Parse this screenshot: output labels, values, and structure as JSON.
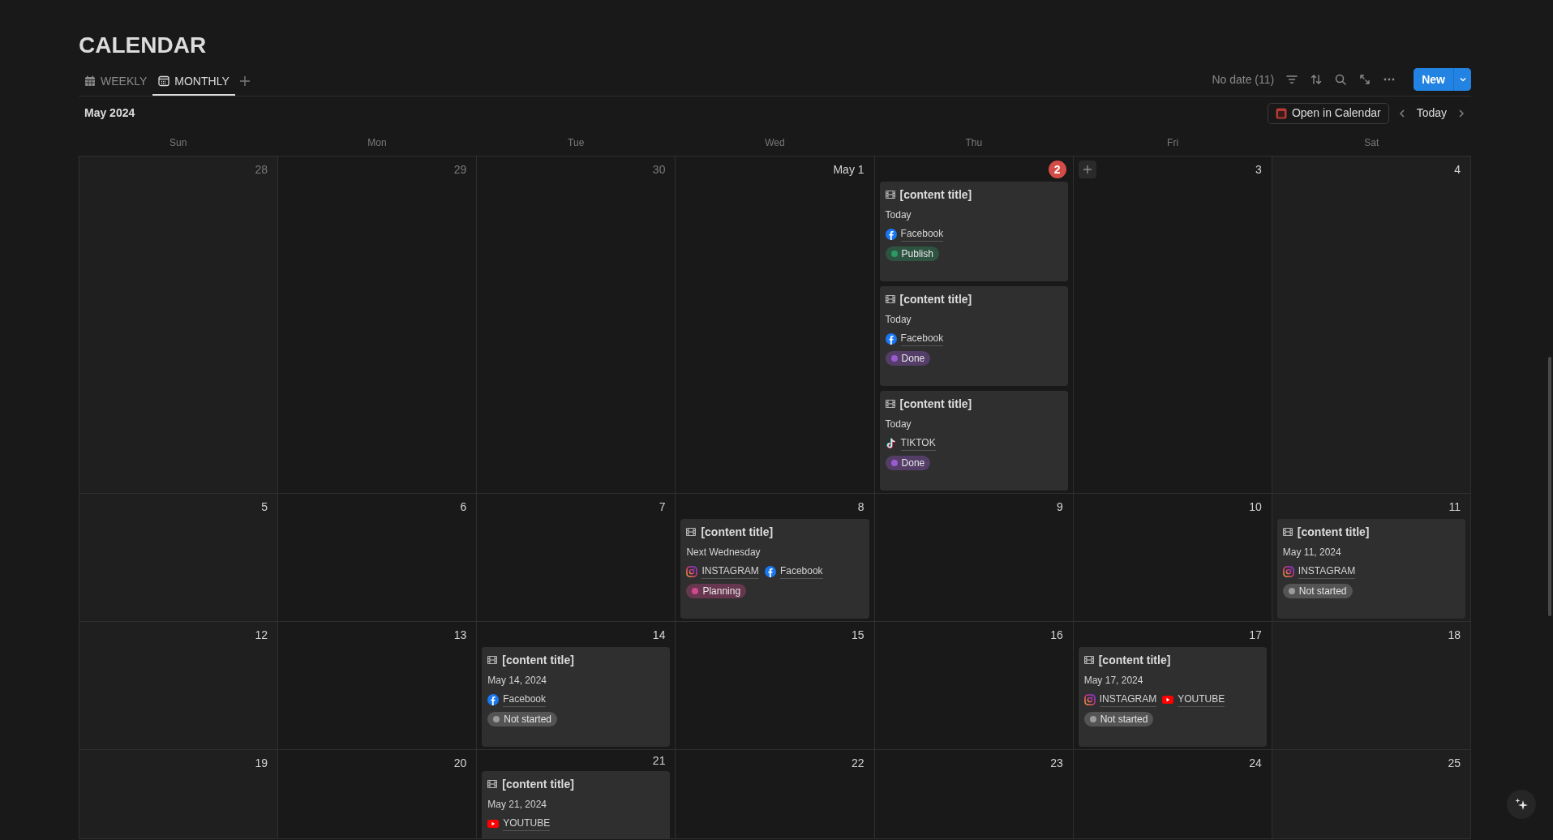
{
  "page_title": "CALENDAR",
  "tabs": [
    {
      "label": "WEEKLY",
      "kind": "week",
      "selected": false
    },
    {
      "label": "MONTHLY",
      "kind": "month",
      "selected": true
    }
  ],
  "toolbar": {
    "no_date": "No date (11)",
    "new_button": "New"
  },
  "month_label": "May 2024",
  "open_in_calendar": "Open in Calendar",
  "today_button": "Today",
  "weekdays": [
    "Sun",
    "Mon",
    "Tue",
    "Wed",
    "Thu",
    "Fri",
    "Sat"
  ],
  "weeks": [
    [
      {
        "day": "28",
        "in_month": false,
        "today": false,
        "hovered": false
      },
      {
        "day": "29",
        "in_month": false,
        "today": false,
        "hovered": false
      },
      {
        "day": "30",
        "in_month": false,
        "today": false,
        "hovered": false
      },
      {
        "day": "May 1",
        "in_month": true,
        "today": false,
        "hovered": false
      },
      {
        "day": "2",
        "in_month": true,
        "today": true,
        "hovered": false,
        "events": [
          {
            "title": "[content title]",
            "date": "Today",
            "platforms": [
              {
                "name": "Facebook",
                "kind": "facebook"
              }
            ],
            "status": {
              "label": "Publish",
              "color": "#2d9964"
            }
          },
          {
            "title": "[content title]",
            "date": "Today",
            "platforms": [
              {
                "name": "Facebook",
                "kind": "facebook"
              }
            ],
            "status": {
              "label": "Done",
              "color": "#9a5bd0"
            }
          },
          {
            "title": "[content title]",
            "date": "Today",
            "platforms": [
              {
                "name": "TIKTOK",
                "kind": "tiktok"
              }
            ],
            "status": {
              "label": "Done",
              "color": "#9a5bd0"
            }
          }
        ]
      },
      {
        "day": "3",
        "in_month": true,
        "today": false,
        "hovered": true
      },
      {
        "day": "4",
        "in_month": true,
        "today": false,
        "hovered": false
      }
    ],
    [
      {
        "day": "5",
        "in_month": true,
        "today": false,
        "hovered": false
      },
      {
        "day": "6",
        "in_month": true,
        "today": false,
        "hovered": false
      },
      {
        "day": "7",
        "in_month": true,
        "today": false,
        "hovered": false
      },
      {
        "day": "8",
        "in_month": true,
        "today": false,
        "hovered": false,
        "events": [
          {
            "title": "[content title]",
            "date": "Next Wednesday",
            "platforms": [
              {
                "name": "INSTAGRAM",
                "kind": "instagram"
              },
              {
                "name": "Facebook",
                "kind": "facebook"
              }
            ],
            "status": {
              "label": "Planning",
              "color": "#d2478e"
            }
          }
        ]
      },
      {
        "day": "9",
        "in_month": true,
        "today": false,
        "hovered": false
      },
      {
        "day": "10",
        "in_month": true,
        "today": false,
        "hovered": false
      },
      {
        "day": "11",
        "in_month": true,
        "today": false,
        "hovered": false,
        "events": [
          {
            "title": "[content title]",
            "date": "May 11, 2024",
            "platforms": [
              {
                "name": "INSTAGRAM",
                "kind": "instagram"
              }
            ],
            "status": {
              "label": "Not started",
              "color": "#9b9b9b"
            }
          }
        ]
      }
    ],
    [
      {
        "day": "12",
        "in_month": true,
        "today": false,
        "hovered": false
      },
      {
        "day": "13",
        "in_month": true,
        "today": false,
        "hovered": false
      },
      {
        "day": "14",
        "in_month": true,
        "today": false,
        "hovered": false,
        "events": [
          {
            "title": "[content title]",
            "date": "May 14, 2024",
            "platforms": [
              {
                "name": "Facebook",
                "kind": "facebook"
              }
            ],
            "status": {
              "label": "Not started",
              "color": "#9b9b9b"
            }
          }
        ]
      },
      {
        "day": "15",
        "in_month": true,
        "today": false,
        "hovered": false
      },
      {
        "day": "16",
        "in_month": true,
        "today": false,
        "hovered": false
      },
      {
        "day": "17",
        "in_month": true,
        "today": false,
        "hovered": false,
        "events": [
          {
            "title": "[content title]",
            "date": "May 17, 2024",
            "platforms": [
              {
                "name": "INSTAGRAM",
                "kind": "instagram"
              },
              {
                "name": "YOUTUBE",
                "kind": "youtube"
              }
            ],
            "status": {
              "label": "Not started",
              "color": "#9b9b9b"
            }
          }
        ]
      },
      {
        "day": "18",
        "in_month": true,
        "today": false,
        "hovered": false
      }
    ],
    [
      {
        "day": "19",
        "in_month": true,
        "today": false,
        "hovered": false
      },
      {
        "day": "20",
        "in_month": true,
        "today": false,
        "hovered": false
      },
      {
        "day": "21",
        "in_month": true,
        "today": false,
        "hovered": false,
        "events": [
          {
            "title": "[content title]",
            "date": "May 21, 2024",
            "platforms": [
              {
                "name": "YOUTUBE",
                "kind": "youtube"
              }
            ]
          }
        ]
      },
      {
        "day": "22",
        "in_month": true,
        "today": false,
        "hovered": false
      },
      {
        "day": "23",
        "in_month": true,
        "today": false,
        "hovered": false
      },
      {
        "day": "24",
        "in_month": true,
        "today": false,
        "hovered": false
      },
      {
        "day": "25",
        "in_month": true,
        "today": false,
        "hovered": false
      }
    ]
  ]
}
